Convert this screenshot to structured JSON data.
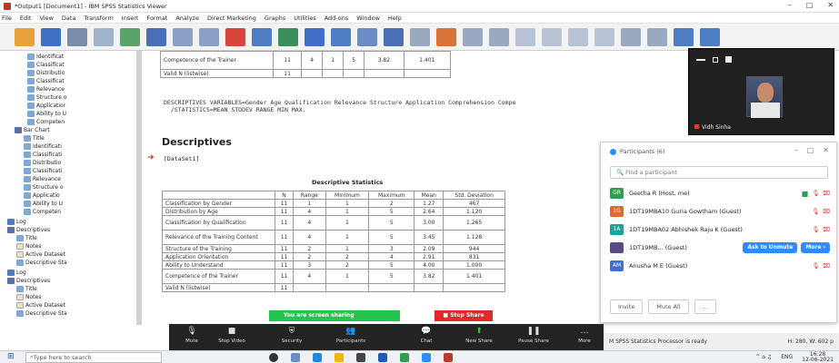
{
  "window": {
    "title": "*Output1 [Document1] - IBM SPSS Statistics Viewer"
  },
  "menu": [
    "File",
    "Edit",
    "View",
    "Data",
    "Transform",
    "Insert",
    "Format",
    "Analyze",
    "Direct Marketing",
    "Graphs",
    "Utilities",
    "Add-ons",
    "Window",
    "Help"
  ],
  "outline": {
    "items": [
      "Identificat",
      "Classificat",
      "Distributio",
      "Classificat",
      "Relevance",
      "Structure o",
      "Applicatior",
      "Ability to U",
      "Competen",
      "Bar Chart",
      "Title",
      "Identificati",
      "Classificati",
      "Distributio",
      "Classificati",
      "Relevance",
      "Structure o",
      "Applicatio",
      "Ability to U",
      "Competen",
      "Log",
      "Descriptives",
      "Title",
      "Notes",
      "Active Dataset",
      "Descriptive Sta",
      "Log",
      "Descriptives",
      "Title",
      "Notes",
      "Active Dataset",
      "Descriptive Sta"
    ]
  },
  "top_table": {
    "rows": [
      {
        "label": "Competence of the Trainer",
        "values": [
          "11",
          "4",
          "1",
          "5",
          "3.82",
          "1.401"
        ]
      },
      {
        "label": "Valid N (listwise)",
        "values": [
          "11",
          "",
          "",
          "",
          "",
          ""
        ]
      }
    ]
  },
  "syntax": {
    "line1": "DESCRIPTIVES VARIABLES=Gender Age Qualification Relevance Structure Application Comprehension Compe",
    "line2": "  /STATISTICS=MEAN STDDEV RANGE MIN MAX."
  },
  "section": {
    "heading": "Descriptives",
    "dataset": "[DataSet1]"
  },
  "desc_table": {
    "title": "Descriptive Statistics",
    "columns": [
      "N",
      "Range",
      "Minimum",
      "Maximum",
      "Mean",
      "Std. Deviation"
    ],
    "rows": [
      {
        "label": "Classification by Gender",
        "values": [
          "11",
          "1",
          "1",
          "2",
          "1.27",
          "467"
        ]
      },
      {
        "label": "Distribution by Age",
        "values": [
          "11",
          "4",
          "1",
          "5",
          "2.64",
          "1.120"
        ]
      },
      {
        "label": "Classification by Qualification",
        "values": [
          "11",
          "4",
          "1",
          "5",
          "3.00",
          "1.265"
        ]
      },
      {
        "label": "Relevance of the Training Content",
        "values": [
          "11",
          "4",
          "1",
          "5",
          "3.45",
          "1.128"
        ]
      },
      {
        "label": "Structure of the Training",
        "values": [
          "11",
          "2",
          "1",
          "3",
          "2.09",
          "944"
        ]
      },
      {
        "label": "Application Orientation",
        "values": [
          "11",
          "2",
          "2",
          "4",
          "2.91",
          "831"
        ]
      },
      {
        "label": "Ability to Understand",
        "values": [
          "11",
          "3",
          "2",
          "5",
          "4.00",
          "1.000"
        ]
      },
      {
        "label": "Competence of the Trainer",
        "values": [
          "11",
          "4",
          "1",
          "5",
          "3.82",
          "1.401"
        ]
      },
      {
        "label": "Valid N (listwise)",
        "values": [
          "11",
          "",
          "",
          "",
          "",
          ""
        ]
      }
    ]
  },
  "video": {
    "name": "Vidh Sinha"
  },
  "participants": {
    "title": "Participants (6)",
    "search_placeholder": "Find a participant",
    "list": [
      {
        "initials": "GR",
        "color": "#2e9e4f",
        "name": "Geetha R (Host, me)"
      },
      {
        "initials": "1G",
        "color": "#e8642b",
        "name": "1DT19MBA10 Guria Gowtham (Guest)"
      },
      {
        "initials": "1A",
        "color": "#1aa39a",
        "name": "1DT19MBA02 Abhishek Raju K (Guest)"
      },
      {
        "initials": "",
        "color": "#5b4a8a",
        "name": "1DT19MB... (Guest)"
      },
      {
        "initials": "AM",
        "color": "#3f6fd1",
        "name": "Anusha M E (Guest)"
      }
    ],
    "ask_unmute": "Ask to Unmute",
    "more": "More ›",
    "invite": "Invite",
    "mute_all": "Mute All",
    "dots": "..."
  },
  "sharing": {
    "status": "You are screen sharing",
    "stop": "Stop Share"
  },
  "zoom_toolbar": [
    "Mute",
    "Stop Video",
    "Security",
    "Participants",
    "Chat",
    "New Share",
    "Pause Share",
    "More"
  ],
  "status": {
    "left": "M SPSS Statistics Processor is ready",
    "right": "H: 280, W: 602 p"
  },
  "taskbar": {
    "search_placeholder": "Type here to search",
    "time": "16:28",
    "date": "12-06-2021",
    "lang": "ENG"
  }
}
